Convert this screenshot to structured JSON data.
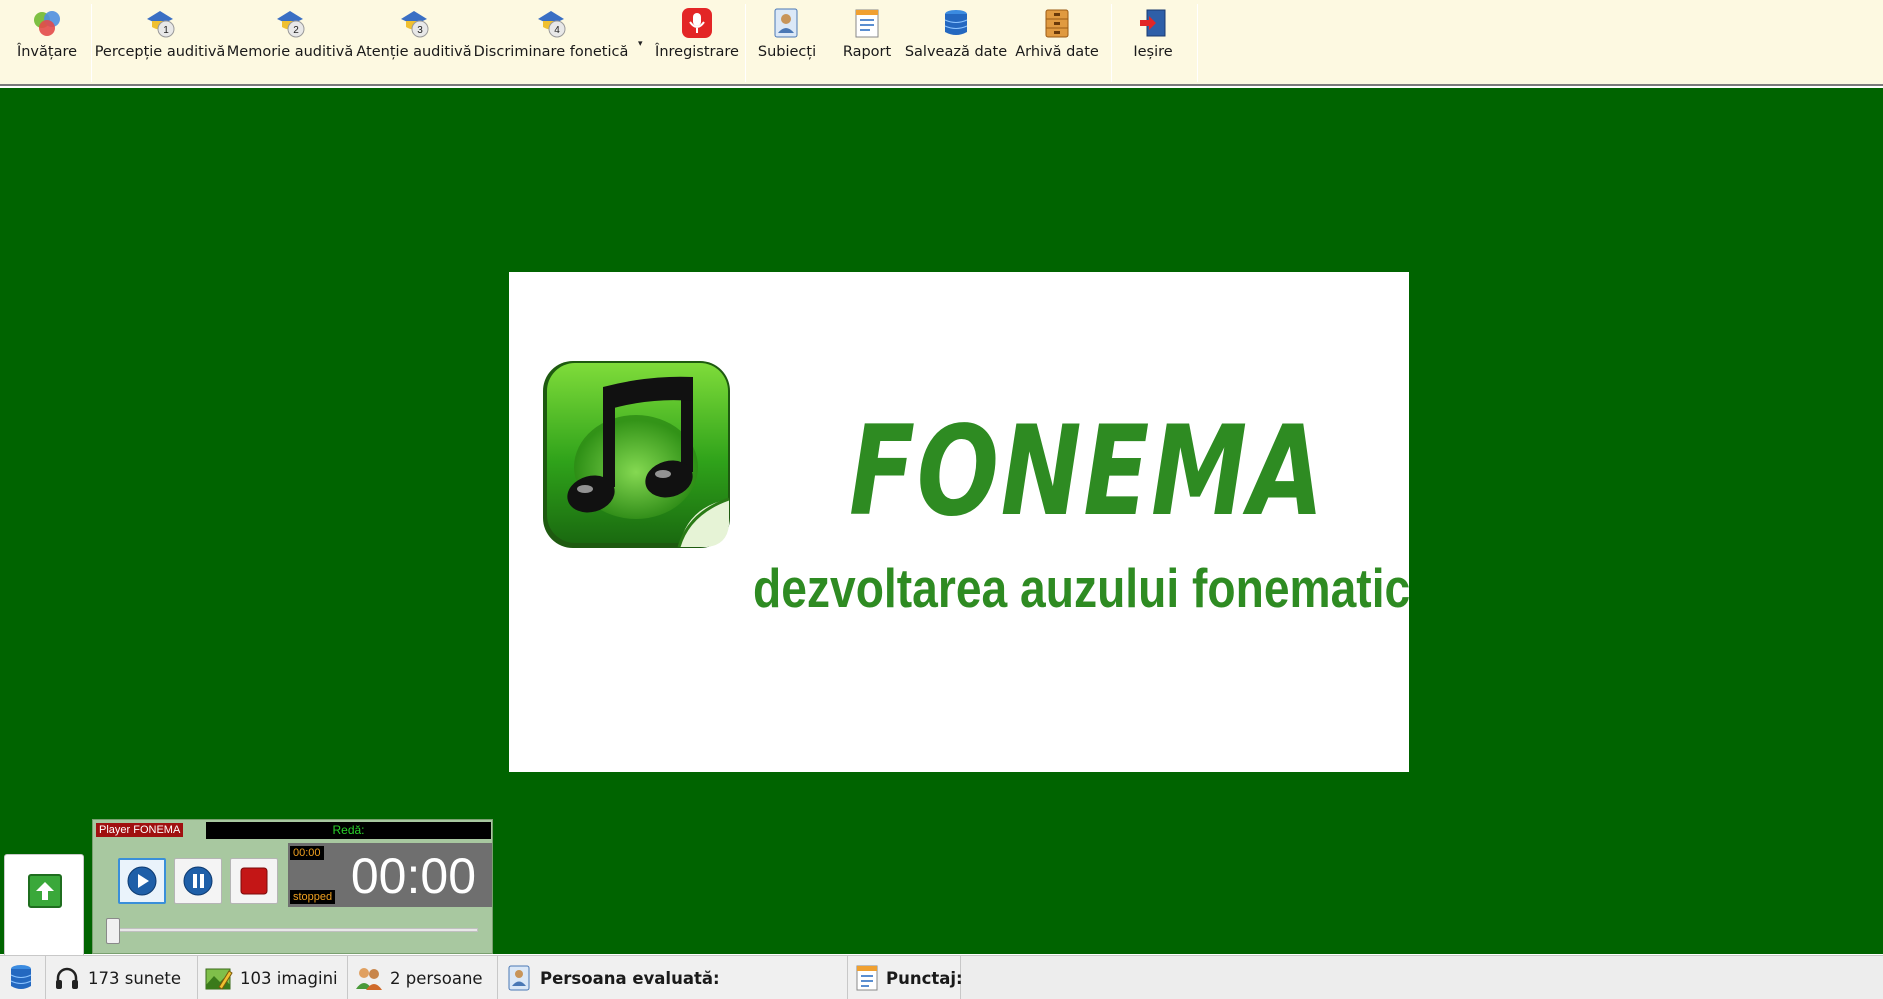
{
  "toolbar": {
    "items": [
      {
        "label": "Învățare",
        "icon": "learning-icon"
      },
      {
        "label": "Percepție auditivă",
        "icon": "perception-icon"
      },
      {
        "label": "Memorie auditivă",
        "icon": "memory-icon"
      },
      {
        "label": "Atenție auditivă",
        "icon": "attention-icon"
      },
      {
        "label": "Discriminare fonetică",
        "icon": "discrimination-icon"
      },
      {
        "label": "Înregistrare",
        "icon": "microphone-icon"
      },
      {
        "label": "Subiecți",
        "icon": "subjects-icon"
      },
      {
        "label": "Raport",
        "icon": "report-icon"
      },
      {
        "label": "Salvează date",
        "icon": "database-icon"
      },
      {
        "label": "Arhivă date",
        "icon": "archive-icon"
      },
      {
        "label": "Ieșire",
        "icon": "exit-icon"
      }
    ],
    "badges": [
      "1",
      "2",
      "3",
      "4"
    ],
    "dropdown_arrow": "▾"
  },
  "splash": {
    "title": "FONEMA",
    "subtitle": "dezvoltarea auzului fonematic",
    "logo_icon": "music-note-icon"
  },
  "player": {
    "title": "Player FONEMA",
    "status": "Redă:",
    "time_small": "00:00",
    "time_big": "00:00",
    "state": "stopped",
    "progress": 0
  },
  "statusbar": {
    "sounds": "173 sunete",
    "images": "103 imagini",
    "persons": "2 persoane",
    "evaluated_label": "Persoana evaluată:",
    "score_label": "Punctaj:"
  },
  "colors": {
    "toolbar_bg": "#fdf9e1",
    "main_bg": "#006400",
    "brand_green": "#2e8b22",
    "player_bg": "#a8c8a0",
    "player_title_bg": "#a01010"
  }
}
